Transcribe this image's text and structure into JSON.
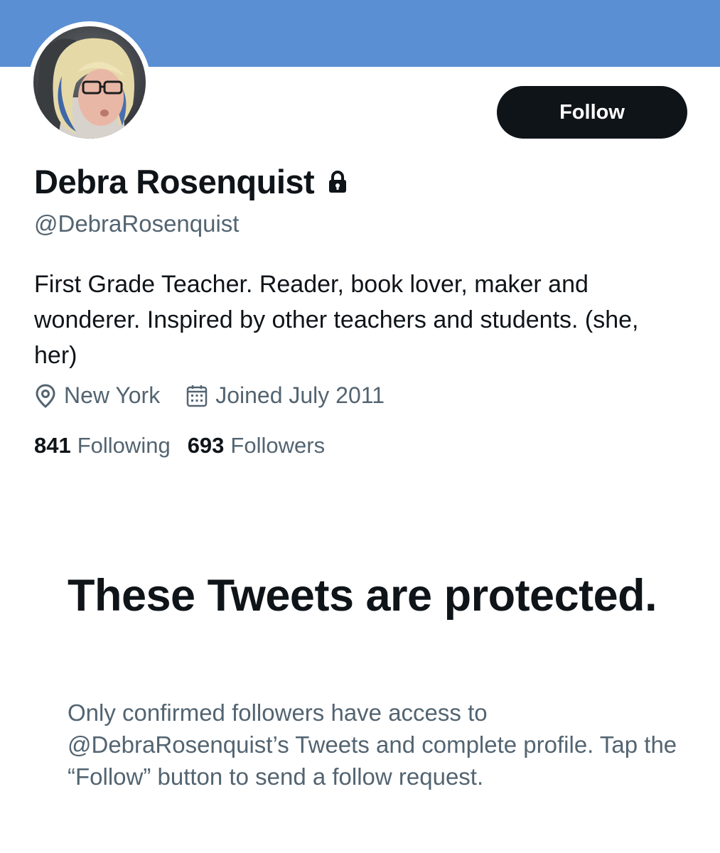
{
  "profile": {
    "display_name": "Debra Rosenquist",
    "handle": "@DebraRosenquist",
    "bio": "First Grade Teacher. Reader, book lover, maker and wonderer. Inspired by other teachers and students. (she, her)",
    "location": "New York",
    "joined": "Joined July 2011",
    "following_count": "841",
    "following_label": "Following",
    "followers_count": "693",
    "followers_label": "Followers",
    "protected_icon": "lock-icon",
    "location_icon": "location-pin-icon",
    "joined_icon": "calendar-icon"
  },
  "actions": {
    "follow_label": "Follow"
  },
  "protected_notice": {
    "title": "These Tweets are protected.",
    "description": "Only confirmed followers have access to @DebraRosenquist’s Tweets and complete profile. Tap the “Follow” button to send a follow request."
  },
  "colors": {
    "banner": "#5a8fd3",
    "primary_text": "#0f1419",
    "secondary_text": "#536471",
    "button_bg": "#0f1419"
  }
}
